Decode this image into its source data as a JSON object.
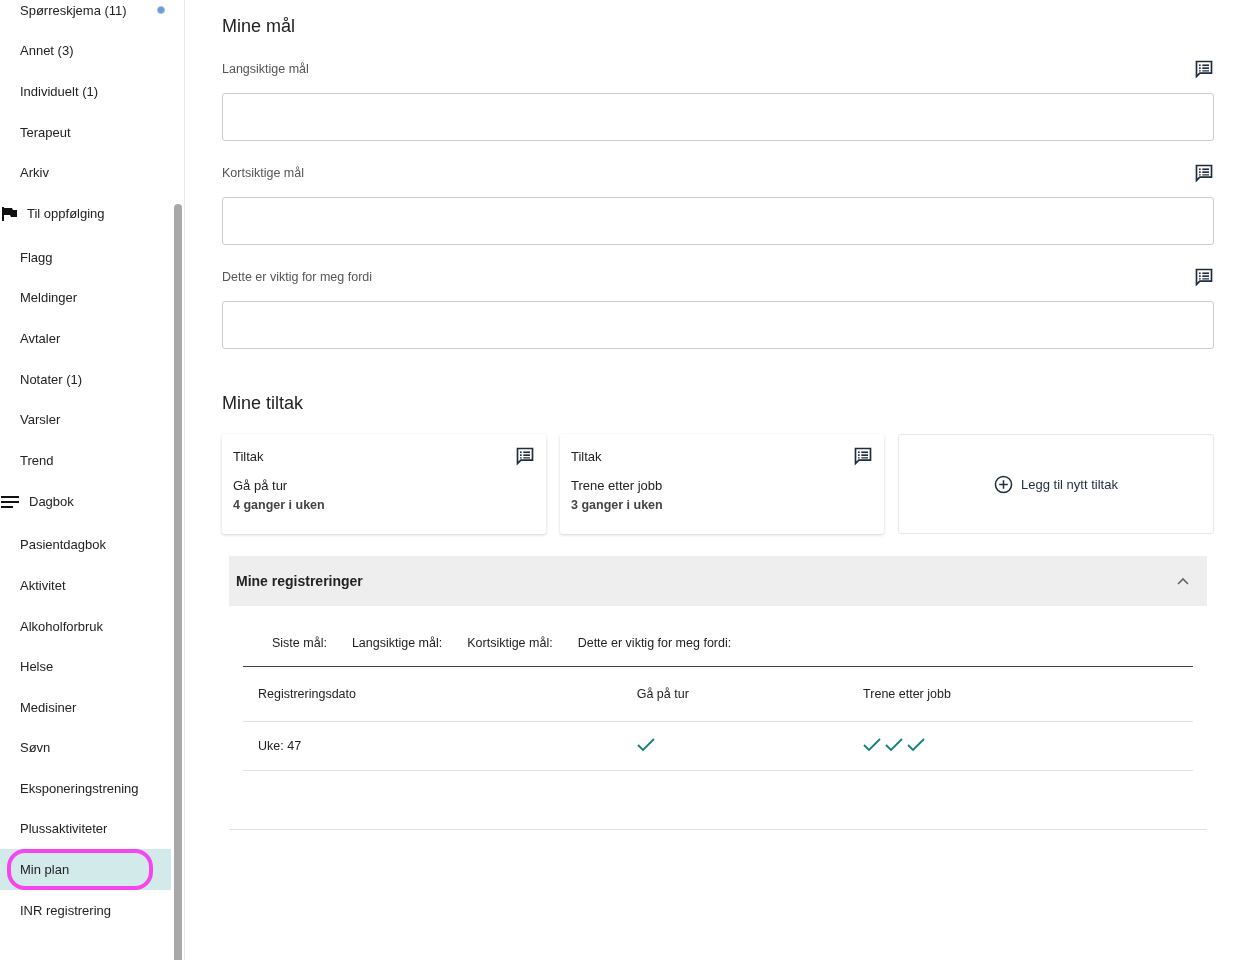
{
  "sidebar": {
    "items": [
      {
        "kind": "item",
        "label": "Spørreskjema (11)",
        "selected": false,
        "badge": true
      },
      {
        "kind": "item",
        "label": "Annet (3)",
        "selected": false
      },
      {
        "kind": "item",
        "label": "Individuelt (1)",
        "selected": false
      },
      {
        "kind": "item",
        "label": "Terapeut",
        "selected": false
      },
      {
        "kind": "item",
        "label": "Arkiv",
        "selected": false
      },
      {
        "kind": "flag_header",
        "label": "Til oppfølging"
      },
      {
        "kind": "item",
        "label": "Flagg",
        "selected": false
      },
      {
        "kind": "item",
        "label": "Meldinger",
        "selected": false
      },
      {
        "kind": "item",
        "label": "Avtaler",
        "selected": false
      },
      {
        "kind": "item",
        "label": "Notater (1)",
        "selected": false
      },
      {
        "kind": "item",
        "label": "Varsler",
        "selected": false
      },
      {
        "kind": "item",
        "label": "Trend",
        "selected": false
      },
      {
        "kind": "list_header",
        "label": "Dagbok"
      },
      {
        "kind": "item",
        "label": "Pasientdagbok",
        "selected": false
      },
      {
        "kind": "item",
        "label": "Aktivitet",
        "selected": false
      },
      {
        "kind": "item",
        "label": "Alkoholforbruk",
        "selected": false
      },
      {
        "kind": "item",
        "label": "Helse",
        "selected": false
      },
      {
        "kind": "item",
        "label": "Medisiner",
        "selected": false
      },
      {
        "kind": "item",
        "label": "Søvn",
        "selected": false
      },
      {
        "kind": "item",
        "label": "Eksponeringstrening",
        "selected": false
      },
      {
        "kind": "item",
        "label": "Plussaktiviteter",
        "selected": false
      },
      {
        "kind": "item",
        "label": "Min plan",
        "selected": true,
        "circled": true
      },
      {
        "kind": "item",
        "label": "INR registrering",
        "selected": false
      }
    ]
  },
  "goals": {
    "title": "Mine mål",
    "fields": [
      {
        "label": "Langsiktige mål"
      },
      {
        "label": "Kortsiktige mål"
      },
      {
        "label": "Dette er viktig for meg fordi"
      }
    ]
  },
  "measures": {
    "title": "Mine tiltak",
    "cards": [
      {
        "title": "Tiltak",
        "name": "Gå på tur",
        "frequency": "4 ganger i uken"
      },
      {
        "title": "Tiltak",
        "name": "Trene etter jobb",
        "frequency": "3 ganger i uken"
      }
    ],
    "add_button": "Legg til nytt tiltak"
  },
  "registrations": {
    "title": "Mine registreringer",
    "expanded": true,
    "summary": [
      "Siste mål:",
      "Langsiktige mål:",
      "Kortsiktige mål:",
      "Dette er viktig for meg fordi:"
    ],
    "columns": [
      "Registreringsdato",
      "Gå på tur",
      "Trene etter jobb"
    ],
    "rows": [
      {
        "date": "Uke: 47",
        "checks": [
          [
            {
              "done": true
            }
          ],
          [
            {
              "done": true
            },
            {
              "done": true
            },
            {
              "done": true
            }
          ]
        ]
      }
    ]
  }
}
